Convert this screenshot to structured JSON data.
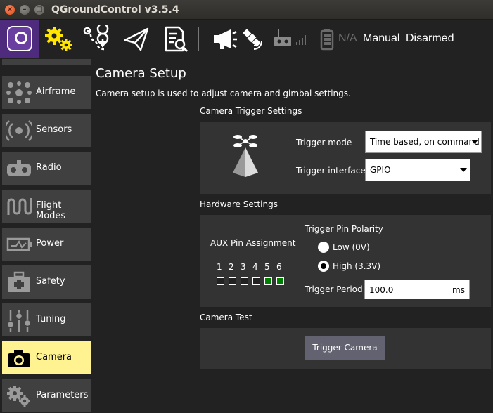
{
  "window": {
    "title": "QGroundControl v3.5.4"
  },
  "toolbar": {
    "battery": "N/A",
    "flight_mode": "Manual",
    "arm_state": "Disarmed"
  },
  "sidebar": {
    "items": [
      {
        "label": "Airframe"
      },
      {
        "label": "Sensors"
      },
      {
        "label": "Radio"
      },
      {
        "label": "Flight Modes"
      },
      {
        "label": "Power"
      },
      {
        "label": "Safety"
      },
      {
        "label": "Tuning"
      },
      {
        "label": "Camera",
        "active": true
      },
      {
        "label": "Parameters"
      }
    ]
  },
  "page": {
    "title": "Camera Setup",
    "description": "Camera setup is used to adjust camera and gimbal settings."
  },
  "trigger_settings": {
    "section_title": "Camera Trigger Settings",
    "mode_label": "Trigger mode",
    "mode_value": "Time based, on command",
    "interface_label": "Trigger interface",
    "interface_value": "GPIO"
  },
  "hardware": {
    "section_title": "Hardware Settings",
    "aux_label": "AUX Pin Assignment",
    "pins": [
      "1",
      "2",
      "3",
      "4",
      "5",
      "6"
    ],
    "pins_enabled": [
      false,
      false,
      false,
      false,
      true,
      true
    ],
    "polarity_label": "Trigger Pin Polarity",
    "polarity_low": "Low (0V)",
    "polarity_high": "High (3.3V)",
    "polarity_selected": "High (3.3V)",
    "period_label": "Trigger Period",
    "period_value": "100.0",
    "period_unit": "ms"
  },
  "camera_test": {
    "section_title": "Camera Test",
    "button_label": "Trigger Camera"
  },
  "colors": {
    "active_sidebar": "#fff291",
    "logo_bg": "#4f2b7d",
    "pin_on": "#008000",
    "toolbar_accent": "#ffe500"
  }
}
